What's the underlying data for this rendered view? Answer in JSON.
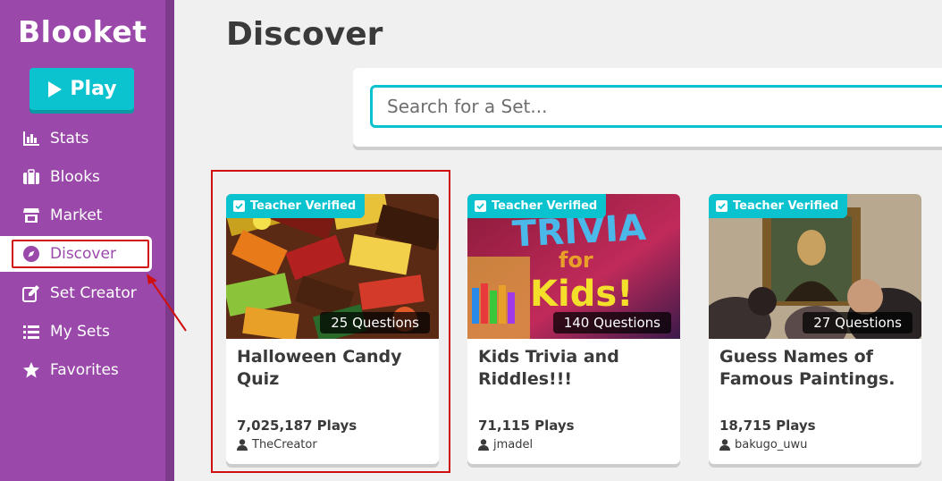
{
  "app": {
    "logo": "Blooket"
  },
  "play_button": {
    "label": "Play"
  },
  "nav": [
    {
      "label": "Stats",
      "icon": "stats-icon"
    },
    {
      "label": "Blooks",
      "icon": "blooks-icon"
    },
    {
      "label": "Market",
      "icon": "market-icon"
    },
    {
      "label": "Discover",
      "icon": "compass-icon",
      "active": true
    },
    {
      "label": "Set Creator",
      "icon": "edit-icon"
    },
    {
      "label": "My Sets",
      "icon": "list-icon"
    },
    {
      "label": "Favorites",
      "icon": "star-icon"
    }
  ],
  "page": {
    "title": "Discover"
  },
  "search": {
    "placeholder": "Search for a Set..."
  },
  "cards": [
    {
      "badge": "Teacher Verified",
      "questions": "25 Questions",
      "title": "Halloween Candy Quiz",
      "plays": "7,025,187 Plays",
      "author": "TheCreator"
    },
    {
      "badge": "Teacher Verified",
      "questions": "140 Questions",
      "title": "Kids Trivia and Riddles!!!",
      "plays": "71,115 Plays",
      "author": "jmadel",
      "image_text": [
        "TRIVIA",
        "for",
        "Kids!"
      ]
    },
    {
      "badge": "Teacher Verified",
      "questions": "27 Questions",
      "title": "Guess Names of Famous Paintings.",
      "plays": "18,715 Plays",
      "author": "bakugo_uwu"
    }
  ],
  "colors": {
    "sidebar": "#9a49aa",
    "accent": "#0bc2cf",
    "highlight": "#d01010"
  }
}
